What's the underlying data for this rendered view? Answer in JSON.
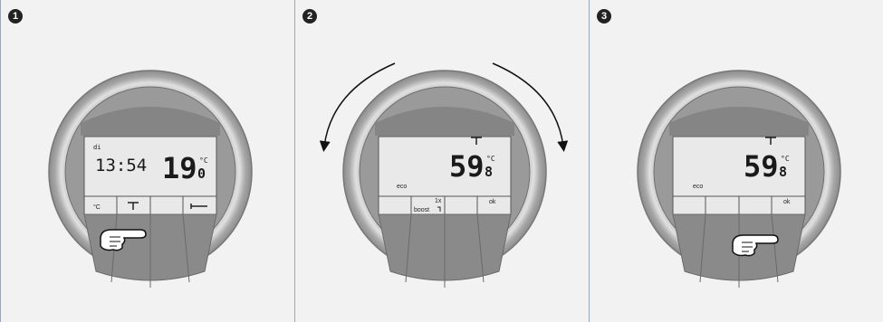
{
  "steps": [
    {
      "number": "1",
      "display": {
        "day": "di",
        "time": "13:54",
        "temp_main": "19",
        "temp_decimal": "0",
        "unit": "°C",
        "buttons": [
          "°C",
          "",
          "",
          ""
        ]
      }
    },
    {
      "number": "2",
      "display": {
        "mode": "eco",
        "temp_main": "59",
        "temp_decimal": "8",
        "unit": "°C",
        "boost_label": "boost",
        "boost_count": "1x",
        "ok_label": "ok"
      }
    },
    {
      "number": "3",
      "display": {
        "mode": "eco",
        "temp_main": "59",
        "temp_decimal": "8",
        "unit": "°C",
        "ok_label": "ok"
      }
    }
  ],
  "colors": {
    "bezel_outer": "#a9a9a9",
    "bezel_inner": "#cfcfcf",
    "face": "#8f8f8f",
    "lcd": "#e9e9e9",
    "badge": "#222222"
  }
}
